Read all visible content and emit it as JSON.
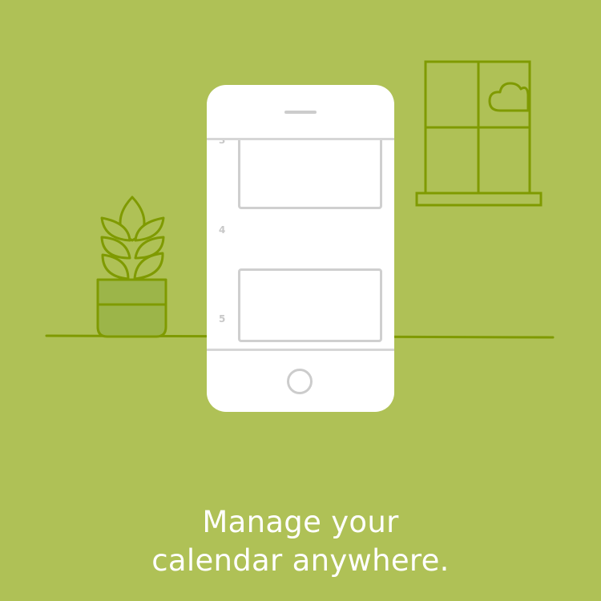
{
  "onboarding": {
    "headline_line1": "Manage your",
    "headline_line2": "calendar anywhere."
  },
  "calendar": {
    "hours": [
      "3",
      "4",
      "5"
    ]
  },
  "colors": {
    "background": "#afc156",
    "illustration_stroke": "#7f9a00",
    "pot_fill": "#9cb549",
    "phone": "#ffffff",
    "phone_lines": "#cccccc",
    "text": "#ffffff"
  },
  "icons": [
    "plant-pot-icon",
    "window-icon",
    "cloud-icon",
    "phone-illustration"
  ]
}
